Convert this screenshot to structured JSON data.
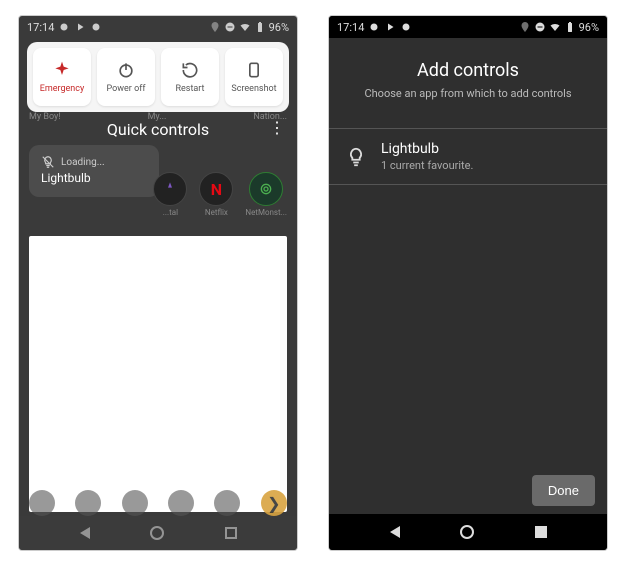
{
  "status": {
    "time": "17:14",
    "battery": "96%"
  },
  "left": {
    "power_menu": {
      "emergency": "Emergency",
      "power_off": "Power off",
      "restart": "Restart",
      "screenshot": "Screenshot"
    },
    "quick_controls_title": "Quick controls",
    "tile": {
      "loading": "Loading...",
      "name": "Lightbulb"
    },
    "ghost": {
      "left_label": "My Boy!",
      "mid_label": "My...",
      "right_label": "Nation...",
      "icon1": "...tal",
      "icon2": "Netflix",
      "icon3": "NetMonst..."
    }
  },
  "right": {
    "title": "Add controls",
    "subtitle": "Choose an app from which to add controls",
    "item": {
      "name": "Lightbulb",
      "sub": "1 current favourite."
    },
    "done": "Done"
  }
}
